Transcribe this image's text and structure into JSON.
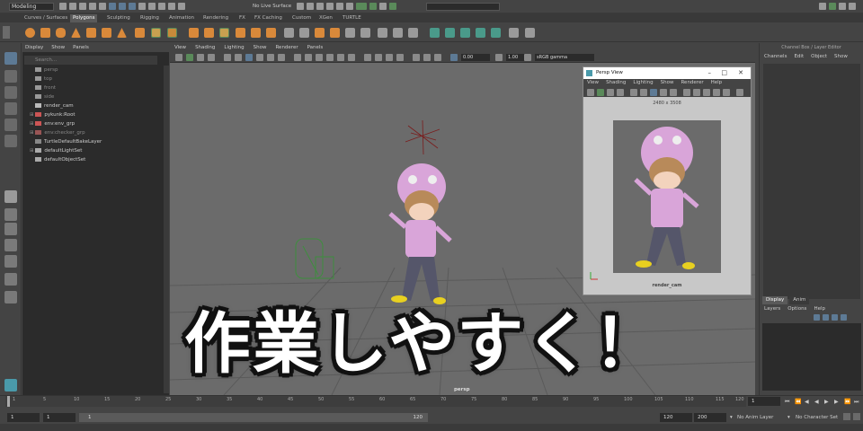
{
  "status_line": {
    "workspace_select": "Modeling",
    "live_surface": "No Live Surface"
  },
  "shelf_tabs": [
    "Curves / Surfaces",
    "Polygons",
    "Sculpting",
    "Rigging",
    "Animation",
    "Rendering",
    "FX",
    "FX Caching",
    "Custom",
    "XGen",
    "TURTLE"
  ],
  "active_shelf_tab": "Polygons",
  "outliner": {
    "menu": [
      "Display",
      "Show",
      "Panels"
    ],
    "search_placeholder": "Search...",
    "items": [
      {
        "label": "persp",
        "dim": true
      },
      {
        "label": "top",
        "dim": true
      },
      {
        "label": "front",
        "dim": true
      },
      {
        "label": "side",
        "dim": true
      },
      {
        "label": "render_cam",
        "dim": false
      },
      {
        "label": "pykunk:Root",
        "dim": false
      },
      {
        "label": "env:env_grp",
        "dim": false
      },
      {
        "label": "env:checker_grp",
        "dim": true
      },
      {
        "label": "TurtleDefaultBakeLayer",
        "dim": false
      },
      {
        "label": "defaultLightSet",
        "dim": false
      },
      {
        "label": "defaultObjectSet",
        "dim": false
      }
    ]
  },
  "viewport": {
    "menu": [
      "View",
      "Shading",
      "Lighting",
      "Show",
      "Renderer",
      "Panels"
    ],
    "exposure": "0.00",
    "gamma": "1.00",
    "colorspace": "sRGB gamma",
    "camera_label": "persp"
  },
  "persp_window": {
    "title": "Persp View",
    "menu": [
      "View",
      "Shading",
      "Lighting",
      "Show",
      "Renderer",
      "Help"
    ],
    "resolution": "2480 x 3508",
    "camera_label": "render_cam"
  },
  "channel_box": {
    "title": "Channel Box / Layer Editor",
    "menu": [
      "Channels",
      "Edit",
      "Object",
      "Show"
    ],
    "layer_tabs": [
      "Display",
      "Anim"
    ],
    "layer_menu": [
      "Layers",
      "Options",
      "Help"
    ]
  },
  "time_slider": {
    "ticks": [
      "1",
      "5",
      "10",
      "15",
      "20",
      "25",
      "30",
      "35",
      "40",
      "45",
      "50",
      "55",
      "60",
      "65",
      "70",
      "75",
      "80",
      "85",
      "90",
      "95",
      "100",
      "105",
      "110",
      "115",
      "120"
    ],
    "current_frame": "1"
  },
  "range_slider": {
    "start": "1",
    "start_inner": "1",
    "range_start": "1",
    "range_end": "120",
    "end_inner": "120",
    "end": "200",
    "anim_layer": "No Anim Layer",
    "character_set": "No Character Set"
  },
  "caption": "作業しやすく！",
  "colors": {
    "ui_bg": "#444444",
    "viewport_bg": "#6b6b6b",
    "outliner_bg": "#2b2b2b",
    "character_pink": "#d9a5d9",
    "accent_blue": "#5d7a95"
  }
}
